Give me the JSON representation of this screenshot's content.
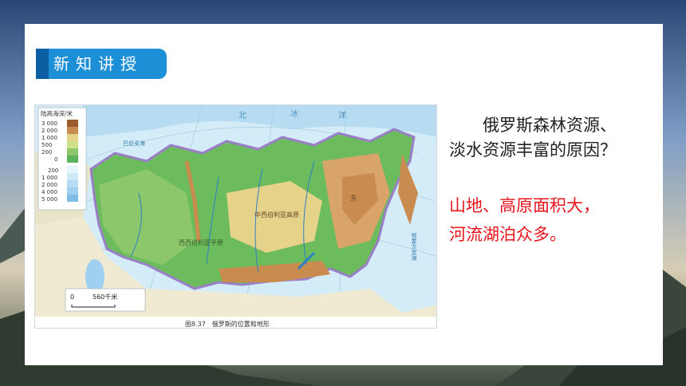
{
  "header": {
    "title": "新知讲授"
  },
  "map": {
    "legend_title": "陆高海深/米",
    "elevation_labels": [
      "3 000",
      "2 000",
      "1 000",
      "500",
      "200",
      "0"
    ],
    "depth_labels": [
      "200",
      "1 000",
      "2 000",
      "4 000",
      "5 000"
    ],
    "scale_label": "560千米",
    "scale_zero": "0",
    "caption": "图8.37　俄罗斯的位置和地形",
    "places": [
      "北",
      "冰",
      "洋",
      "中西伯利亚高原",
      "西西伯利亚平原",
      "东",
      "鄂霍次克海",
      "巴伦支海"
    ],
    "colors": {
      "lowland": "#5bb35a",
      "plain": "#8cc86b",
      "upland": "#e6d38a",
      "mountain": "#c98b4e",
      "highmountain": "#9a5a2e",
      "sea_shallow": "#cfe9f6",
      "sea_deep": "#9fd0ef",
      "border": "#9a7fc7"
    }
  },
  "question": {
    "line1": "俄罗斯森林资源、",
    "line2": "淡水资源丰富的原因？"
  },
  "answer": {
    "line1": "山地、高原面积大，",
    "line2": "河流湖泊众多。"
  }
}
